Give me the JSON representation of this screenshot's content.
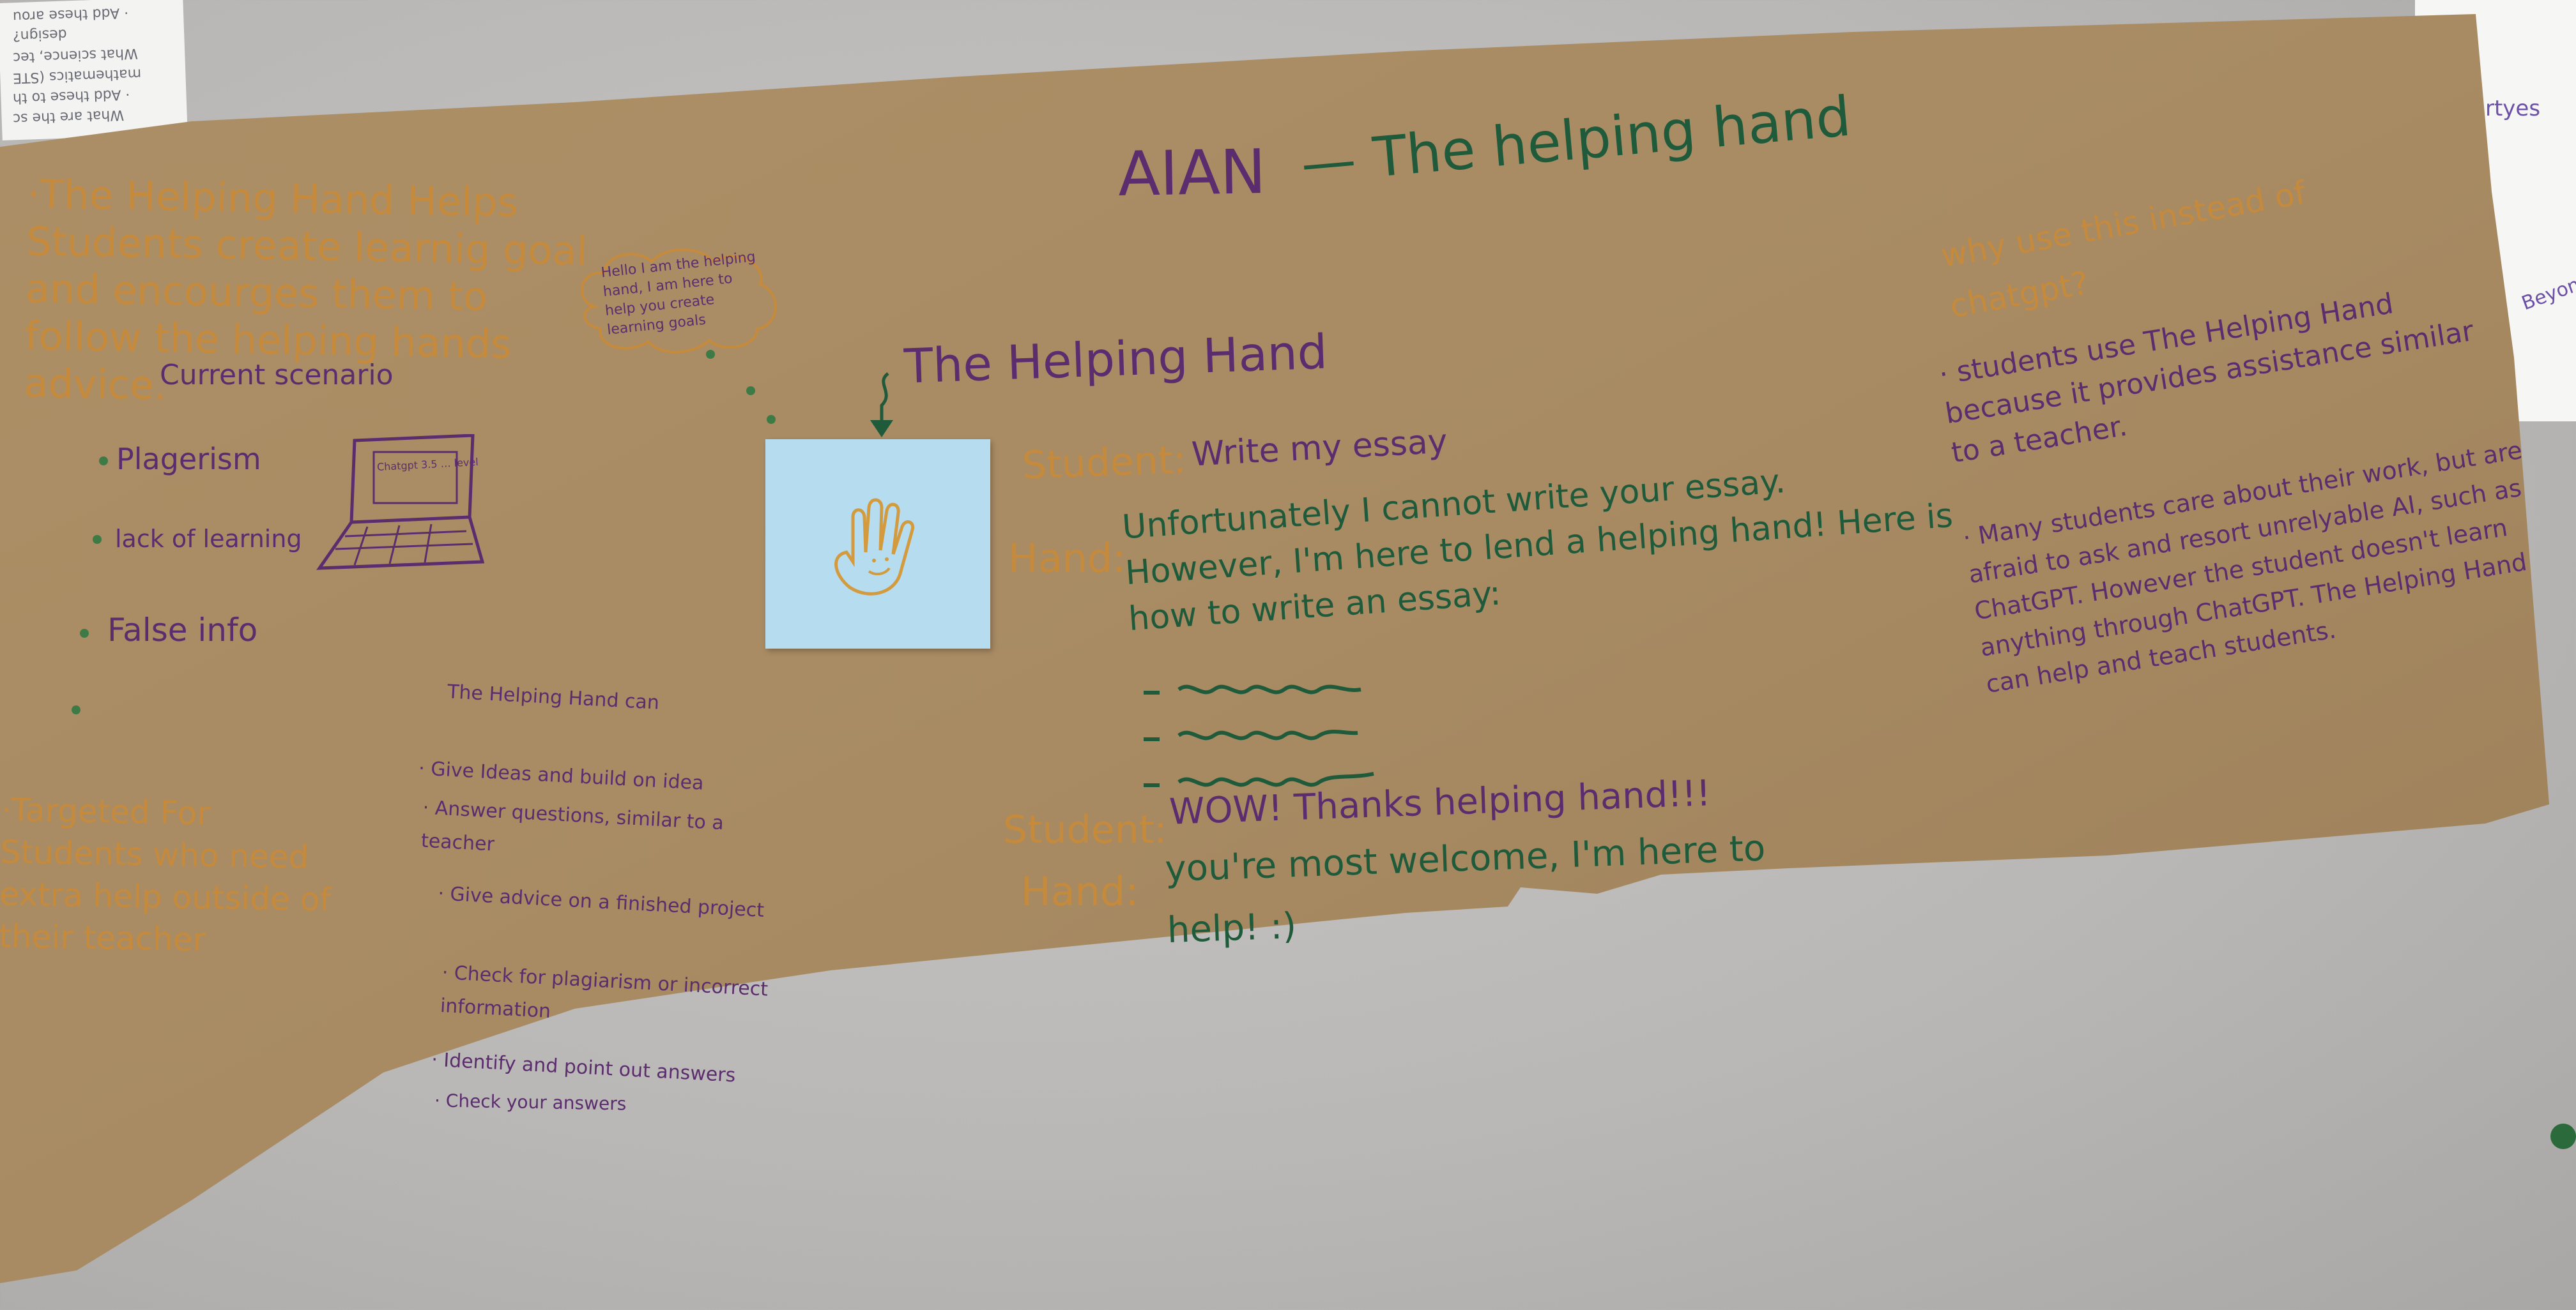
{
  "scraps": {
    "left_lines": [
      "What are the sc",
      "· Add these to th",
      "mathematics (STE",
      "What science, tec",
      "design?",
      "· Add these arou"
    ],
    "right_lines": [
      "rtyes",
      "Beyond"
    ]
  },
  "poster": {
    "title_left": "AIAN",
    "title_right": "— The helping hand",
    "left_block": {
      "intro": "·The Helping Hand Helps Students create learnig goal and encourges them to follow the helping hands advice.",
      "bubble": "Hello I am the helping hand, I am here to help you create learning goals",
      "scenario_title": "Current scenario",
      "scenario_items": [
        "Plagerism",
        "lack of learning",
        "False info"
      ],
      "laptop_screen": "Chatgpt 3.5 … level"
    },
    "targeted": "·Targeted For Students who need extra help outside of their teacher",
    "can_title": "The Helping Hand can",
    "can_items": [
      "· Give Ideas and build on idea",
      "· Answer questions, similar to a teacher",
      "· Give advice on a finished project",
      "· Check for plagiarism or incorrect information",
      "· Identify and point out answers",
      "· Check your answers"
    ],
    "center": {
      "heading": "The Helping Hand",
      "student_label": "Student:",
      "student_line1": "Write my essay",
      "hand_label": "Hand:",
      "hand_response": "Unfortunately I cannot write your essay. However, I'm here to lend a helping hand! Here is how to write an essay:",
      "student_line2": "WOW! Thanks helping hand!!!",
      "hand_line2": "you're most welcome, I'm here to help! :)"
    },
    "right": {
      "question": "why use this instead of chatgpt?",
      "point1": "· students use The Helping Hand because it provides assistance similar to a teacher.",
      "point2": "· Many students care about their work, but are afraid to ask and resort unrelyable AI, such as ChatGPT. However the student doesn't learn anything through ChatGPT. The Helping Hand can help and teach students."
    }
  },
  "colors": {
    "kraft": "#a88b63",
    "orange_ink": "#c68a3c",
    "purple_ink": "#5b2d6e",
    "green_ink": "#1f5a3a",
    "sticky_note": "#b6dcef"
  }
}
